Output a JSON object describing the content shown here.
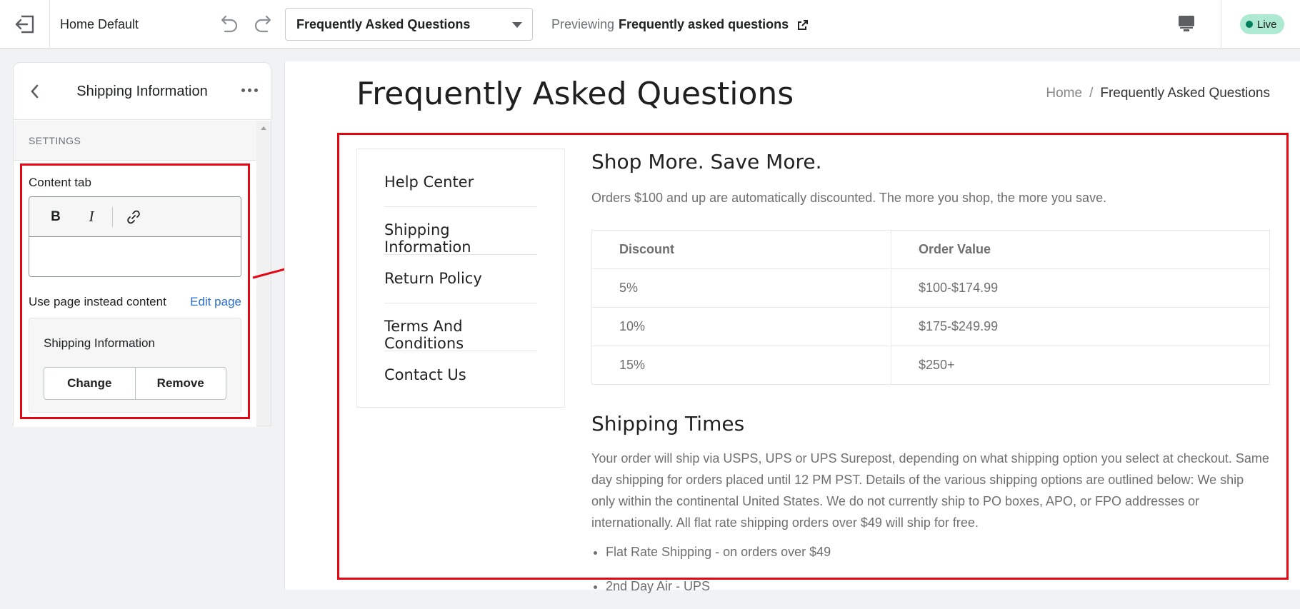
{
  "topbar": {
    "theme_name": "Home Default",
    "selected_page": "Frequently Asked Questions",
    "previewing_label": "Previewing",
    "previewing_page": "Frequently asked questions",
    "status_badge": "Live",
    "status_color": "#007f5f"
  },
  "sidebar": {
    "title": "Shipping Information",
    "section_label": "SETTINGS",
    "content_tab_label": "Content tab",
    "toolbar": {
      "bold": "B",
      "italic": "I"
    },
    "use_page_label": "Use page instead content",
    "edit_page_link": "Edit page",
    "selected_page_name": "Shipping Information",
    "change_button": "Change",
    "remove_button": "Remove"
  },
  "preview": {
    "page_title": "Frequently Asked Questions",
    "breadcrumb": {
      "home": "Home",
      "separator": "/",
      "current": "Frequently Asked Questions"
    },
    "faq_nav": [
      "Help Center",
      "Shipping Information",
      "Return Policy",
      "Terms And Conditions",
      "Contact Us"
    ],
    "section1": {
      "title": "Shop More. Save More.",
      "text": "Orders $100 and up are automatically discounted. The more you shop, the more you save.",
      "table": {
        "headers": [
          "Discount",
          "Order Value"
        ],
        "rows": [
          [
            "5%",
            "$100-$174.99"
          ],
          [
            "10%",
            "$175-$249.99"
          ],
          [
            "15%",
            "$250+"
          ]
        ]
      }
    },
    "section2": {
      "title": "Shipping Times",
      "text": "Your order will ship via USPS, UPS or UPS Surepost, depending on what shipping option you select at checkout. Same day shipping for orders placed until 12 PM PST. Details of the various shipping options are outlined below: We ship only within the continental United States. We do not currently ship to PO boxes, APO, or FPO addresses or internationally. All flat rate shipping orders over $49 will ship for free.",
      "bullets": [
        "Flat Rate Shipping - on orders over $49",
        "2nd Day Air - UPS"
      ]
    }
  },
  "annotation_color": "#e30613"
}
